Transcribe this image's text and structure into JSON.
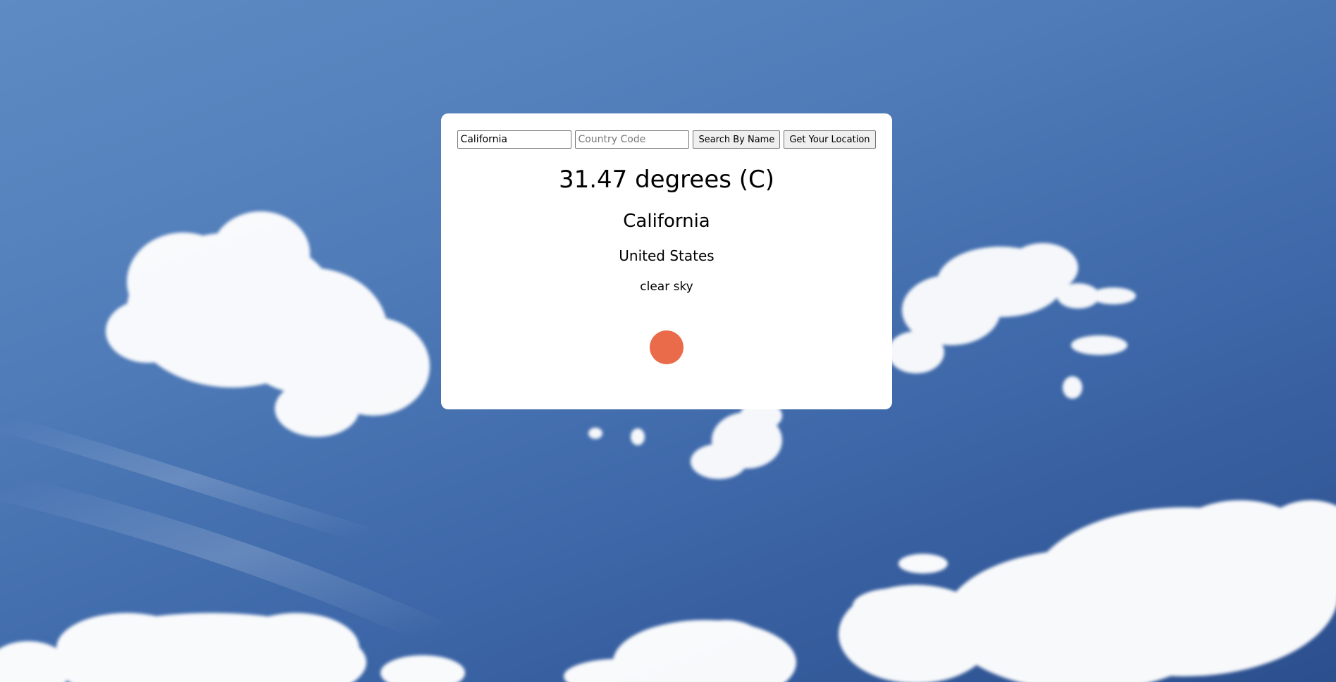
{
  "search": {
    "city_value": "California",
    "city_placeholder": "",
    "country_value": "",
    "country_placeholder": "Country Code",
    "search_button_label": "Search By Name",
    "location_button_label": "Get Your Location"
  },
  "weather": {
    "temperature_text": "31.47 degrees (C)",
    "city": "California",
    "country": "United States",
    "description": "clear sky",
    "icon": "weather-dot-icon",
    "icon_color": "#ea6b4a"
  },
  "colors": {
    "sky": "#4f7bb8",
    "card": "#ffffff"
  }
}
